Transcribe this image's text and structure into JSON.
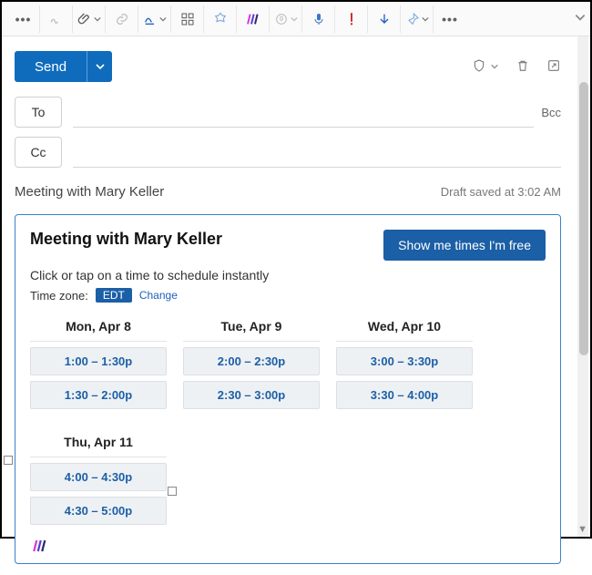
{
  "toolbar": {
    "icons": [
      "dots",
      "signature",
      "attach",
      "link",
      "ink",
      "apps",
      "addin",
      "wave",
      "dictate",
      "mic",
      "important",
      "arrow-down",
      "broom",
      "dots"
    ]
  },
  "send": {
    "label": "Send"
  },
  "actions": {
    "shield": "shield",
    "delete": "delete",
    "popout": "popout"
  },
  "addr": {
    "to_label": "To",
    "cc_label": "Cc",
    "bcc_label": "Bcc"
  },
  "subject": "Meeting with Mary Keller",
  "draft_status": "Draft saved at 3:02 AM",
  "card": {
    "title": "Meeting with Mary Keller",
    "cta": "Show me times I'm free",
    "subtitle": "Click or tap on a time to schedule instantly",
    "tz_label": "Time zone:",
    "tz_value": "EDT",
    "tz_change": "Change",
    "days": [
      {
        "label": "Mon, Apr 8",
        "slots": [
          "1:00 – 1:30p",
          "1:30 – 2:00p"
        ]
      },
      {
        "label": "Tue, Apr 9",
        "slots": [
          "2:00 – 2:30p",
          "2:30 – 3:00p"
        ]
      },
      {
        "label": "Wed, Apr 10",
        "slots": [
          "3:00 – 3:30p",
          "3:30 – 4:00p"
        ]
      },
      {
        "label": "Thu, Apr 11",
        "slots": [
          "4:00 – 4:30p",
          "4:30 – 5:00p"
        ]
      }
    ]
  }
}
